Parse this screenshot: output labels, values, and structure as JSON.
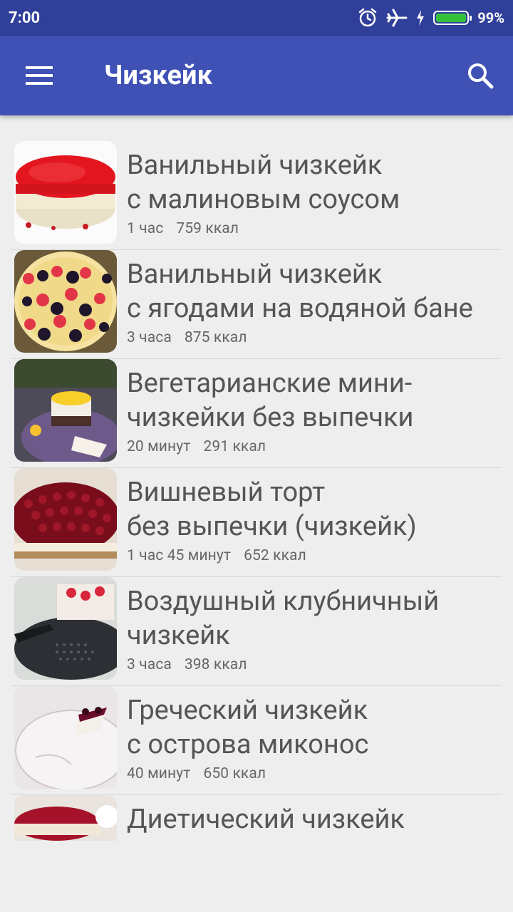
{
  "status_bar": {
    "time": "7:00",
    "battery": "99%",
    "icons": [
      "alarm-icon",
      "airplane-mode-icon",
      "charging-icon",
      "battery-icon"
    ]
  },
  "app_bar": {
    "title": "Чизкейк",
    "menu_icon": "hamburger-menu-icon",
    "search_icon": "search-icon"
  },
  "recipes": [
    {
      "title": "Ванильный чизкейк\nс малиновым соусом",
      "time": "1 час",
      "calories": "759 ккал"
    },
    {
      "title": "Ванильный чизкейк\nс ягодами на водяной бане",
      "time": "3 часа",
      "calories": "875 ккал"
    },
    {
      "title": "Вегетарианские мини-\nчизкейки без выпечки",
      "time": "20 минут",
      "calories": "291 ккал"
    },
    {
      "title": "Вишневый торт\nбез выпечки (чизкейк)",
      "time": "1 час 45 минут",
      "calories": "652 ккал"
    },
    {
      "title": "Воздушный клубничный\nчизкейк",
      "time": "3 часа",
      "calories": "398 ккал"
    },
    {
      "title": "Греческий чизкейк\nс острова миконос",
      "time": "40 минут",
      "calories": "650 ккал"
    },
    {
      "title": "Диетический чизкейк",
      "time": "",
      "calories": ""
    }
  ]
}
